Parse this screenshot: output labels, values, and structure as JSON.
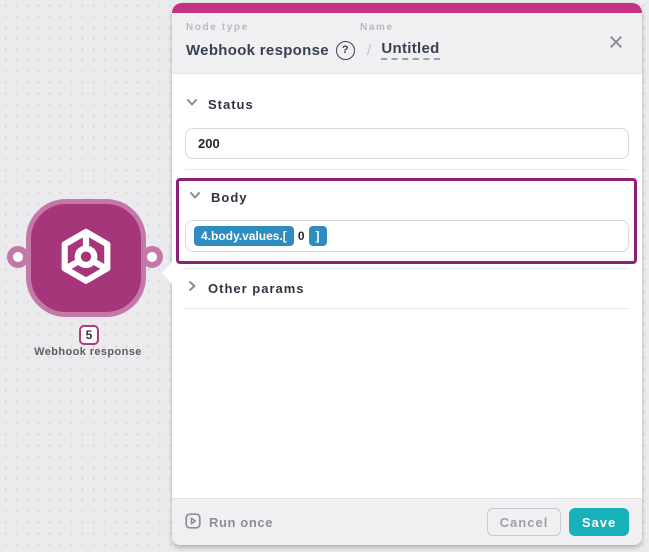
{
  "canvas": {
    "node": {
      "badge": "5",
      "label": "Webhook response"
    }
  },
  "panel": {
    "header": {
      "node_type_label": "Node type",
      "node_type_value": "Webhook response",
      "help_glyph": "?",
      "separator": "/",
      "name_label": "Name",
      "name_value": "Untitled",
      "close_glyph": "×"
    },
    "sections": {
      "status": {
        "label": "Status",
        "value": "200"
      },
      "body": {
        "label": "Body",
        "token_open": "4.body.values.[",
        "index_value": "0",
        "token_close": "]"
      },
      "other_params": {
        "label": "Other params"
      }
    },
    "footer": {
      "run_once_label": "Run once",
      "cancel_label": "Cancel",
      "save_label": "Save"
    }
  },
  "colors": {
    "topbar_pink": "#c53183",
    "node_fill": "#a53679",
    "node_ring": "#c478a7",
    "highlight_purple": "#8b2276",
    "token_blue": "#2e8dc0",
    "save_teal": "#17b1ba"
  }
}
